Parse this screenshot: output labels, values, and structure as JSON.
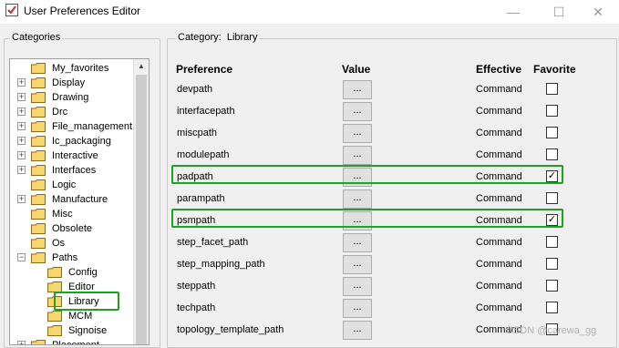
{
  "window": {
    "title": "User Preferences Editor",
    "minimize": "—",
    "maximize": "☐",
    "close": "✕"
  },
  "categories": {
    "label": "Categories",
    "items": [
      {
        "label": "My_favorites",
        "expander": "",
        "indent": 0
      },
      {
        "label": "Display",
        "expander": "+",
        "indent": 0
      },
      {
        "label": "Drawing",
        "expander": "+",
        "indent": 0
      },
      {
        "label": "Drc",
        "expander": "+",
        "indent": 0
      },
      {
        "label": "File_management",
        "expander": "+",
        "indent": 0
      },
      {
        "label": "Ic_packaging",
        "expander": "+",
        "indent": 0
      },
      {
        "label": "Interactive",
        "expander": "+",
        "indent": 0
      },
      {
        "label": "Interfaces",
        "expander": "+",
        "indent": 0
      },
      {
        "label": "Logic",
        "expander": "",
        "indent": 0
      },
      {
        "label": "Manufacture",
        "expander": "+",
        "indent": 0
      },
      {
        "label": "Misc",
        "expander": "",
        "indent": 0
      },
      {
        "label": "Obsolete",
        "expander": "",
        "indent": 0
      },
      {
        "label": "Os",
        "expander": "",
        "indent": 0
      },
      {
        "label": "Paths",
        "expander": "−",
        "indent": 0
      },
      {
        "label": "Config",
        "expander": "",
        "indent": 1
      },
      {
        "label": "Editor",
        "expander": "",
        "indent": 1
      },
      {
        "label": "Library",
        "expander": "",
        "indent": 1,
        "selected": true
      },
      {
        "label": "MCM",
        "expander": "",
        "indent": 1
      },
      {
        "label": "Signoise",
        "expander": "",
        "indent": 1
      },
      {
        "label": "Placement",
        "expander": "+",
        "indent": 0
      }
    ]
  },
  "category_header": {
    "prefix": "Category:",
    "name": "Library"
  },
  "columns": {
    "preference": "Preference",
    "value": "Value",
    "effective": "Effective",
    "favorite": "Favorite"
  },
  "prefs": [
    {
      "name": "devpath",
      "value": "...",
      "effective": "Command",
      "favorite": false
    },
    {
      "name": "interfacepath",
      "value": "...",
      "effective": "Command",
      "favorite": false
    },
    {
      "name": "miscpath",
      "value": "...",
      "effective": "Command",
      "favorite": false
    },
    {
      "name": "modulepath",
      "value": "...",
      "effective": "Command",
      "favorite": false
    },
    {
      "name": "padpath",
      "value": "...",
      "effective": "Command",
      "favorite": true,
      "highlighted": true
    },
    {
      "name": "parampath",
      "value": "...",
      "effective": "Command",
      "favorite": false
    },
    {
      "name": "psmpath",
      "value": "...",
      "effective": "Command",
      "favorite": true,
      "highlighted": true
    },
    {
      "name": "step_facet_path",
      "value": "...",
      "effective": "Command",
      "favorite": false
    },
    {
      "name": "step_mapping_path",
      "value": "...",
      "effective": "Command",
      "favorite": false
    },
    {
      "name": "steppath",
      "value": "...",
      "effective": "Command",
      "favorite": false
    },
    {
      "name": "techpath",
      "value": "...",
      "effective": "Command",
      "favorite": false
    },
    {
      "name": "topology_template_path",
      "value": "...",
      "effective": "Command",
      "favorite": false
    }
  ],
  "watermark": "CSDN @carewa_gg",
  "colors": {
    "highlight": "#1fa21f",
    "folder": "#f5d76e"
  }
}
